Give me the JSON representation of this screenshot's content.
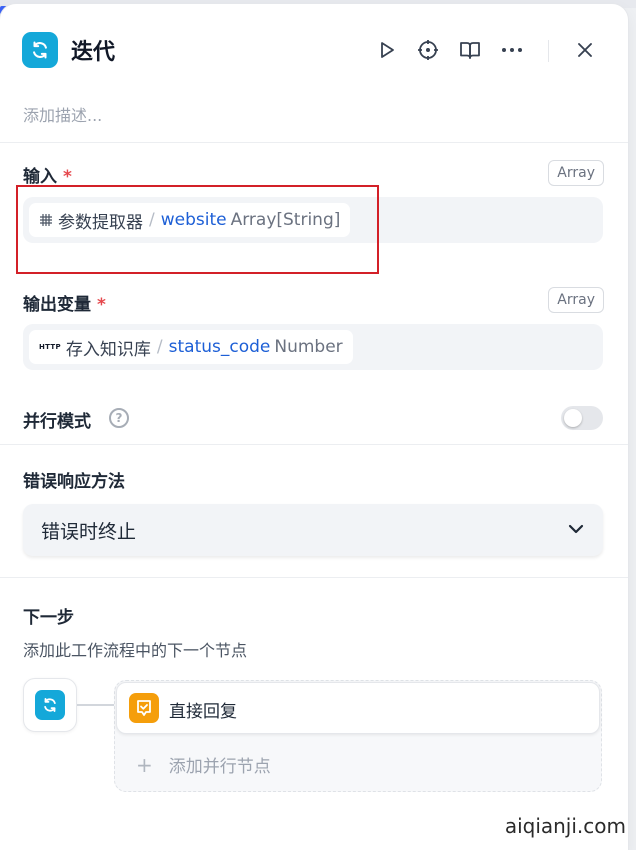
{
  "node": {
    "title": "迭代",
    "description_placeholder": "添加描述..."
  },
  "header_actions": {
    "run_icon": "play-icon",
    "locate_icon": "crosshair-icon",
    "docs_icon": "book-icon",
    "more_icon": "more-icon",
    "close_icon": "close-icon"
  },
  "input": {
    "label": "输入",
    "required_mark": "*",
    "type_badge": "Array",
    "source_node": "参数提取器",
    "separator": "/",
    "variable": "website",
    "variable_type": "Array[String]"
  },
  "output": {
    "label": "输出变量",
    "required_mark": "*",
    "type_badge": "Array",
    "source_tag": "HTTP",
    "source_node": "存入知识库",
    "separator": "/",
    "variable": "status_code",
    "variable_type": "Number"
  },
  "parallel_mode": {
    "label": "并行模式",
    "help_glyph": "?",
    "enabled": false
  },
  "error_handling": {
    "label": "错误响应方法",
    "selected": "错误时终止"
  },
  "next_step": {
    "title": "下一步",
    "subtitle": "添加此工作流程中的下一个节点",
    "next_node_label": "直接回复",
    "add_parallel_label": "添加并行节点",
    "add_glyph": "+"
  },
  "colors": {
    "iteration_icon_bg": "#14a8d9",
    "answer_icon_bg": "#f59e0b",
    "variable_blue": "#1d5fd6",
    "required_red": "#e5484d",
    "highlight_red": "#d32028"
  },
  "watermark": "aiqianji.com"
}
